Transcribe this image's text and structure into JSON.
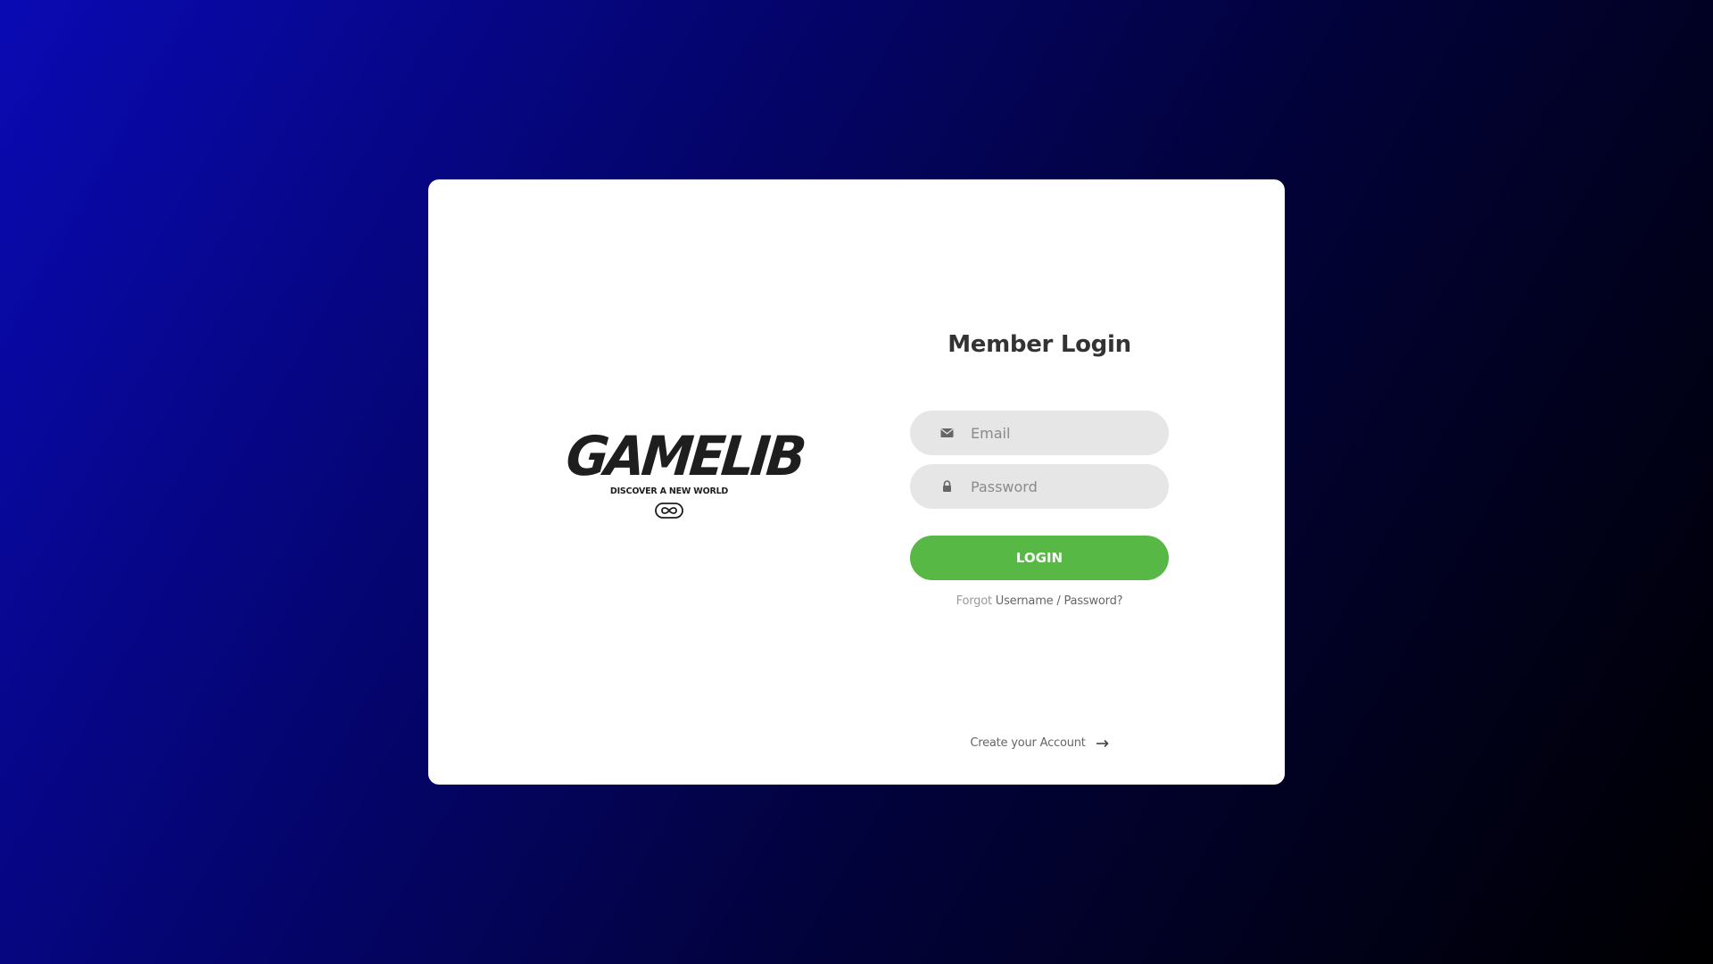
{
  "brand": {
    "logo_text": "GAMELIB",
    "tagline": "DISCOVER A NEW WORLD"
  },
  "login": {
    "title": "Member Login",
    "email": {
      "placeholder": "Email",
      "value": "",
      "icon": "envelope-icon"
    },
    "password": {
      "placeholder": "Password",
      "value": "",
      "icon": "lock-icon"
    },
    "submit_label": "LOGIN",
    "forgot_prefix": "Forgot",
    "forgot_link": "Username / Password?",
    "create_account": "Create your Account",
    "create_icon": "arrow-right-icon"
  },
  "colors": {
    "accent": "#57b846",
    "field_bg": "#e6e6e6",
    "title": "#333333",
    "card_bg": "#ffffff",
    "background_start": "#0a0ab4",
    "background_end": "#000000"
  }
}
